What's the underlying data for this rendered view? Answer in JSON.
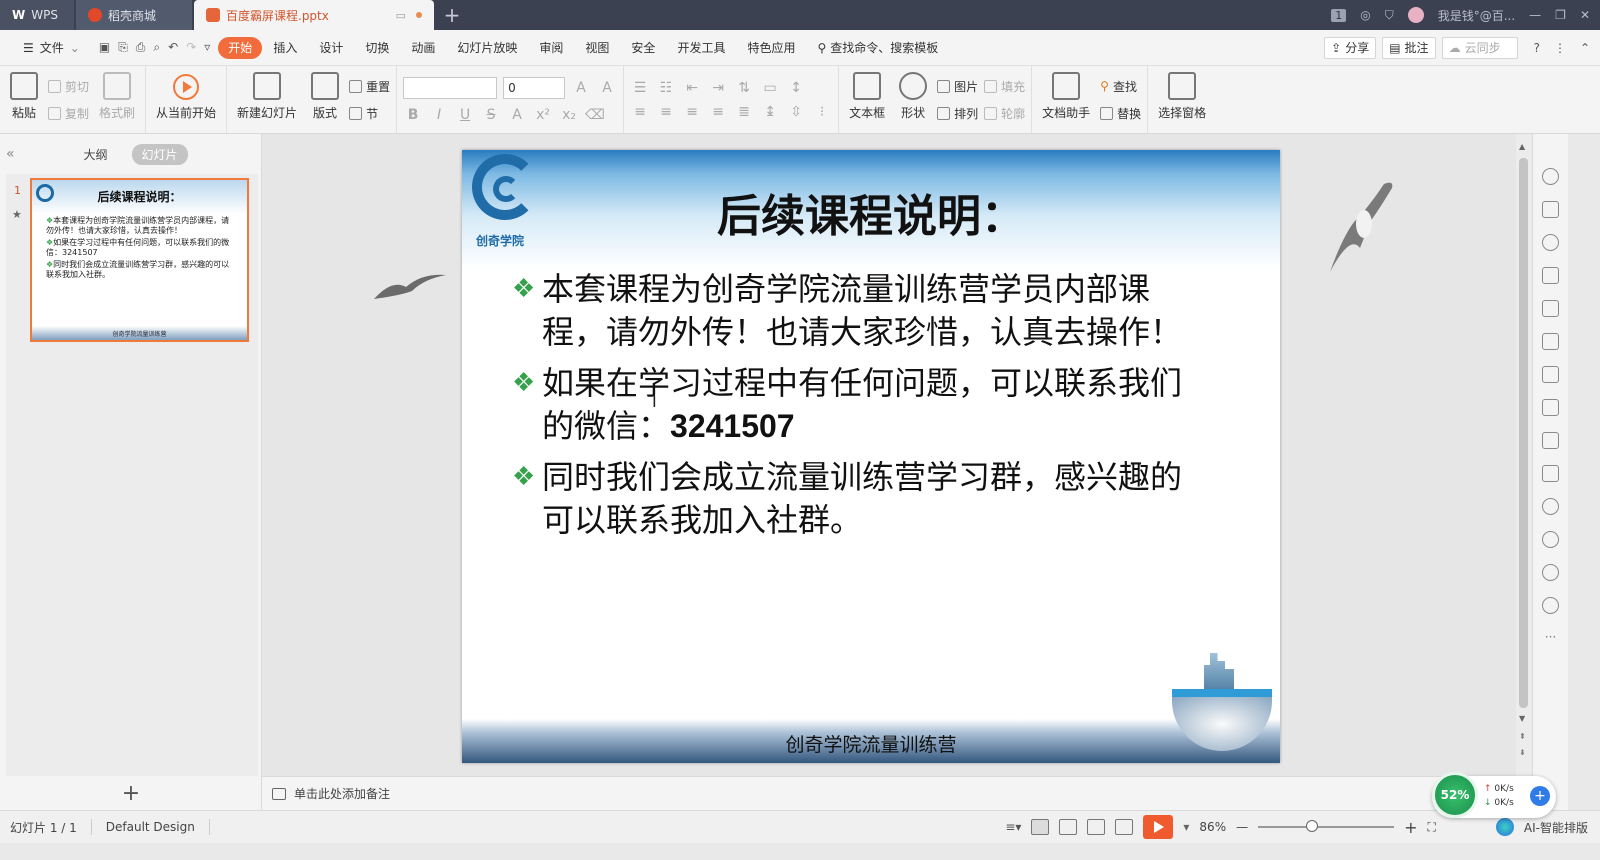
{
  "titlebar": {
    "app_tab": "WPS",
    "shop_tab": "稻壳商城",
    "doc_tab": "百度霸屏课程.pptx",
    "new_tab": "+",
    "window_count": "1",
    "user": "我是钱°@百..."
  },
  "menubar": {
    "file": "文件",
    "items": [
      "开始",
      "插入",
      "设计",
      "切换",
      "动画",
      "幻灯片放映",
      "审阅",
      "视图",
      "安全",
      "开发工具",
      "特色应用"
    ],
    "active": "开始",
    "search": "查找命令、搜索模板",
    "share": "分享",
    "comment": "批注",
    "sync": "云同步",
    "help": "?"
  },
  "ribbon": {
    "paste": "粘贴",
    "cut": "剪切",
    "copy": "复制",
    "format_painter": "格式刷",
    "from_current": "从当前开始",
    "new_slide": "新建幻灯片",
    "layout": "版式",
    "reset": "重置",
    "section": "节",
    "font_name": "",
    "font_size": "0",
    "textbox": "文本框",
    "shape": "形状",
    "picture": "图片",
    "fill": "填充",
    "arrange": "排列",
    "outline": "轮廓",
    "doc_assistant": "文档助手",
    "find": "查找",
    "replace": "替换",
    "selection_pane": "选择窗格"
  },
  "leftpanel": {
    "outline_tab": "大纲",
    "slides_tab": "幻灯片",
    "slide_number": "1",
    "add": "+"
  },
  "slide": {
    "title": "后续课程说明：",
    "logo_text": "创奇学院",
    "bullets": [
      "本套课程为创奇学院流量训练营学员内部课程，请勿外传！也请大家珍惜，认真去操作！",
      "如果在学习过程中有任何问题，可以联系我们的微信：",
      "同时我们会成立流量训练营学习群，感兴趣的可以联系我加入社群。"
    ],
    "wechat": "3241507",
    "footer": "创奇学院流量训练营"
  },
  "notes": {
    "placeholder": "单击此处添加备注"
  },
  "statusbar": {
    "slide_info": "幻灯片 1 / 1",
    "design": "Default Design",
    "zoom": "86%",
    "minus": "—",
    "plus": "+",
    "ai_layout": "AI-智能排版"
  },
  "speed_widget": {
    "percent": "52%",
    "up": "0K/s",
    "down": "0K/s"
  },
  "colors": {
    "accent": "#f26b3a",
    "titlebar": "#3b4150",
    "bullet_marker": "#34a24a",
    "logo_blue": "#1f6ca8"
  }
}
